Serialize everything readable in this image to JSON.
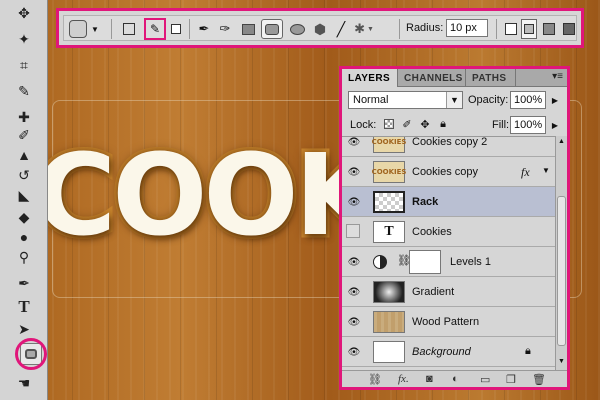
{
  "canvas": {
    "text": "COOKI"
  },
  "toolbox": {
    "tools": [
      "move-tool",
      "magic-wand-tool",
      "crop-tool",
      "eyedropper-tool",
      "spot-healing-tool",
      "brush-tool",
      "clone-stamp-tool",
      "history-brush-tool",
      "eraser-tool",
      "paint-bucket-tool",
      "blur-tool",
      "dodge-tool",
      "pen-tool",
      "type-tool",
      "path-selection-tool",
      "rounded-rectangle-tool",
      "hand-tool"
    ],
    "type_glyph": "T"
  },
  "options_bar": {
    "radius_label": "Radius:",
    "radius_value": "10 px",
    "selected_mode": "paths"
  },
  "layers_panel": {
    "tabs": [
      "LAYERS",
      "CHANNELS",
      "PATHS"
    ],
    "active_tab": "LAYERS",
    "menu_glyph": "▾≡",
    "blend_mode": "Normal",
    "opacity_label": "Opacity:",
    "opacity_value": "100%",
    "lock_label": "Lock:",
    "fill_label": "Fill:",
    "fill_value": "100%",
    "layers": [
      {
        "name": "Cookies copy 2",
        "visible": true,
        "thumb": "cookie",
        "thumb_text": "COOKIES"
      },
      {
        "name": "Cookies copy",
        "visible": true,
        "thumb": "cookie",
        "thumb_text": "COOKIES",
        "fx": "fx"
      },
      {
        "name": "Rack",
        "visible": true,
        "thumb": "transparent",
        "selected": true
      },
      {
        "name": "Cookies",
        "visible": false,
        "thumb": "type",
        "thumb_text": "T"
      },
      {
        "name": "Levels 1",
        "visible": true,
        "thumb": "adjustment"
      },
      {
        "name": "Gradient",
        "visible": true,
        "thumb": "gradient"
      },
      {
        "name": "Wood Pattern",
        "visible": true,
        "thumb": "wood"
      },
      {
        "name": "Background",
        "visible": true,
        "thumb": "white",
        "locked": true
      }
    ]
  },
  "colors": {
    "highlight": "#e0167a",
    "selected_row": "#b9bfd2"
  }
}
